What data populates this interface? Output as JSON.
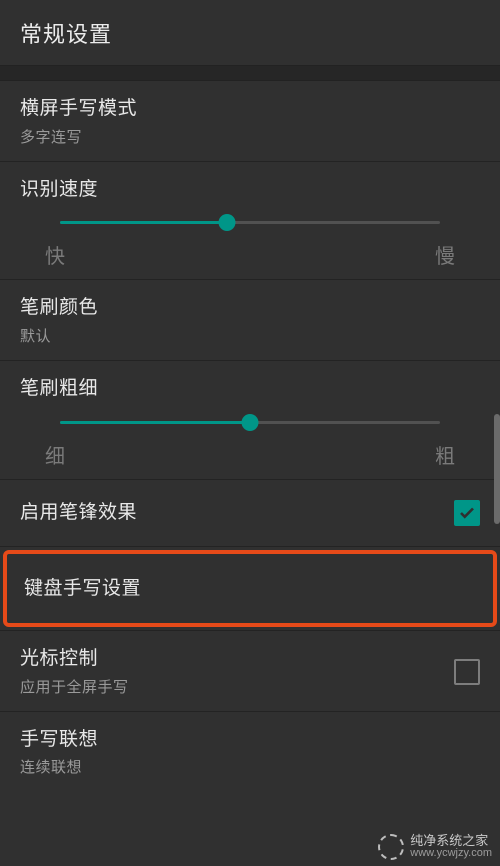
{
  "header": {
    "title": "常规设置"
  },
  "items": {
    "landscape": {
      "title": "横屏手写模式",
      "sub": "多字连写"
    },
    "speed": {
      "title": "识别速度",
      "left": "快",
      "right": "慢",
      "percent": 44
    },
    "brushColor": {
      "title": "笔刷颜色",
      "sub": "默认"
    },
    "brushSize": {
      "title": "笔刷粗细",
      "left": "细",
      "right": "粗",
      "percent": 50
    },
    "strokeEffect": {
      "title": "启用笔锋效果",
      "checked": true
    },
    "keyboardHandwrite": {
      "title": "键盘手写设置"
    },
    "cursorControl": {
      "title": "光标控制",
      "sub": "应用于全屏手写",
      "checked": false
    },
    "association": {
      "title": "手写联想",
      "sub": "连续联想"
    }
  },
  "watermark": {
    "line1": "纯净系统之家",
    "line2": "www.ycwjzy.com"
  }
}
